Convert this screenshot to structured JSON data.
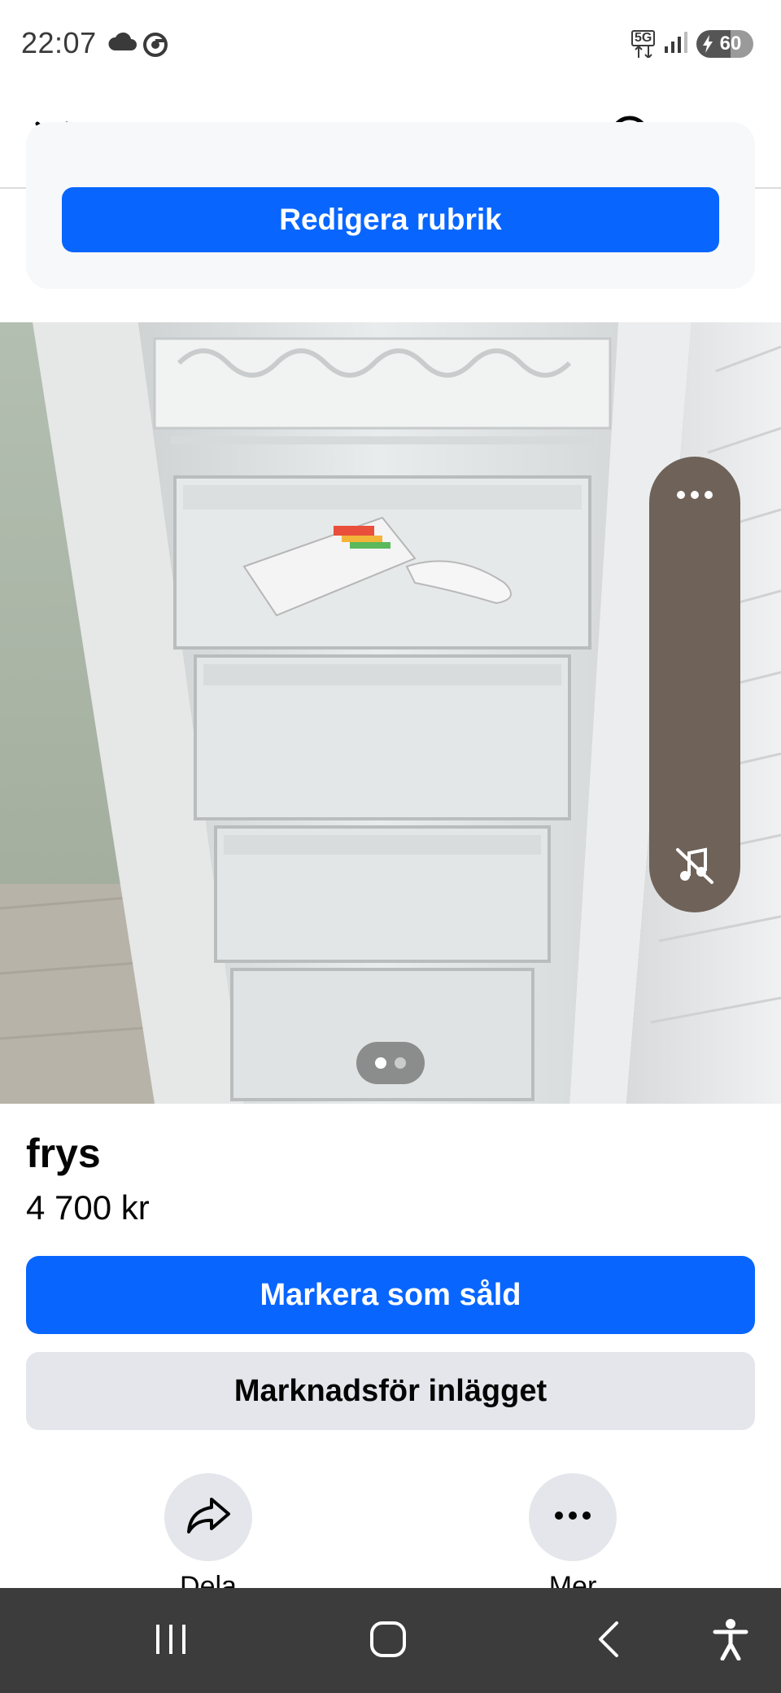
{
  "status_bar": {
    "time": "22:07",
    "left_icons": [
      "cloud-icon",
      "chrome-icon"
    ],
    "network": "5G",
    "battery_level": "60",
    "battery_fraction": 0.6
  },
  "nav": {
    "close_icon": "close-icon",
    "search_icon": "search-icon",
    "more_icon": "more-icon"
  },
  "card": {
    "edit_title_label": "Redigera rubrik"
  },
  "photo": {
    "page_index": 1,
    "page_count": 2
  },
  "listing": {
    "title": "frys",
    "price": "4 700 kr"
  },
  "buttons": {
    "mark_sold": "Markera som såld",
    "promote": "Marknadsför inlägget"
  },
  "actions": [
    {
      "label": "Dela",
      "icon": "share-icon"
    },
    {
      "label": "Mer",
      "icon": "more-icon"
    }
  ],
  "system_nav": {
    "icons": [
      "recents-icon",
      "home-icon",
      "back-icon",
      "accessibility-icon"
    ]
  },
  "colors": {
    "brand_blue": "#0866ff",
    "secondary_button": "#e4e6eb",
    "side_pill": "#6e6259",
    "system_nav_bg": "#3c3c3c"
  }
}
